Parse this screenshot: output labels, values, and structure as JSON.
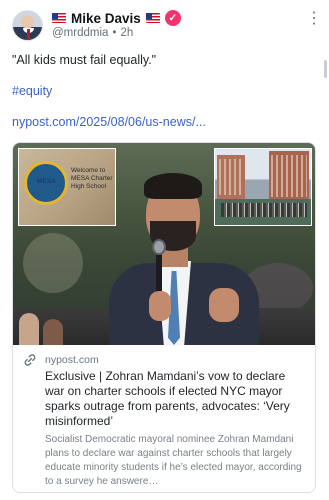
{
  "author": {
    "display_name": "Mike Davis",
    "handle": "@mrddmia",
    "separator": "•",
    "time_ago": "2h",
    "flag_left": "us-flag-emoji",
    "flag_right": "us-flag-emoji",
    "verified_badge": "✓",
    "verified_color": "#f2336e"
  },
  "post": {
    "text": "\"All kids must fail equally.\"",
    "hashtag": "#equity",
    "link_text": "nypost.com/2025/08/06/us-news/..."
  },
  "link_card": {
    "image_alt": "Zohran Mamdani speaking into a microphone with inset photos of a charter school sign and a school building",
    "inset_sign_text": "Welcome to MESA Charter High School",
    "inset_seal_text": "MESA",
    "domain": "nypost.com",
    "headline": "Exclusive | Zohran Mamdani’s vow to declare war on charter schools if elected NYC mayor sparks outrage from parents, advocates: ‘Very misinformed’",
    "description": "Socialist Democratic mayoral nominee Zohran Mamdani plans to declare war against charter schools that largely educate minority students if he’s elected mayor, according to a survey he answere…"
  },
  "menu_icon": "⋮",
  "link_icon": "link-icon",
  "colors": {
    "link": "#3b63c7",
    "muted": "#6b7380",
    "border": "#dde1e6"
  }
}
